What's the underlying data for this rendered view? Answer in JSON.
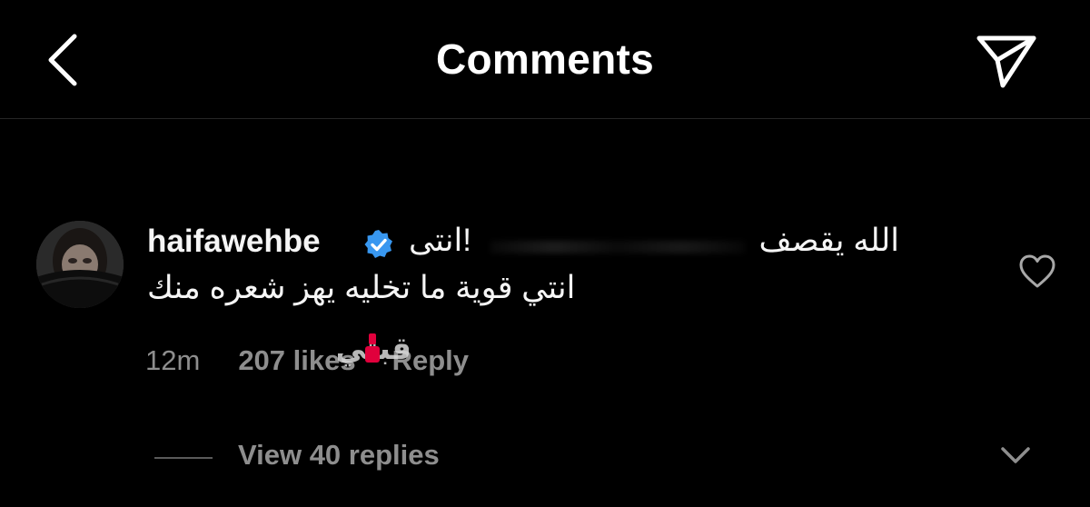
{
  "header": {
    "title": "Comments",
    "back_icon": "chevron-left-icon",
    "share_icon": "paper-plane-icon"
  },
  "comment": {
    "username": "haifawehbe",
    "verified_icon": "verified-badge-icon",
    "verified_color": "#3897f0",
    "text_line1_start": "الله يقصف",
    "text_line1_end": "!انتى",
    "text_line2": "انتي قوية ما تخليه يهز شعره منك",
    "time": "12m",
    "likes": "207 likes",
    "reply_label": "Reply",
    "heart_icon": "heart-outline-icon",
    "view_replies": "View 40 replies",
    "expand_icon": "chevron-down-icon"
  },
  "watermark": {
    "text": "فوشيا",
    "color": "#e0003c"
  },
  "colors": {
    "background": "#000000",
    "primary_text": "#f5f5f5",
    "secondary_text": "#8e8e8e",
    "divider": "#262626"
  }
}
